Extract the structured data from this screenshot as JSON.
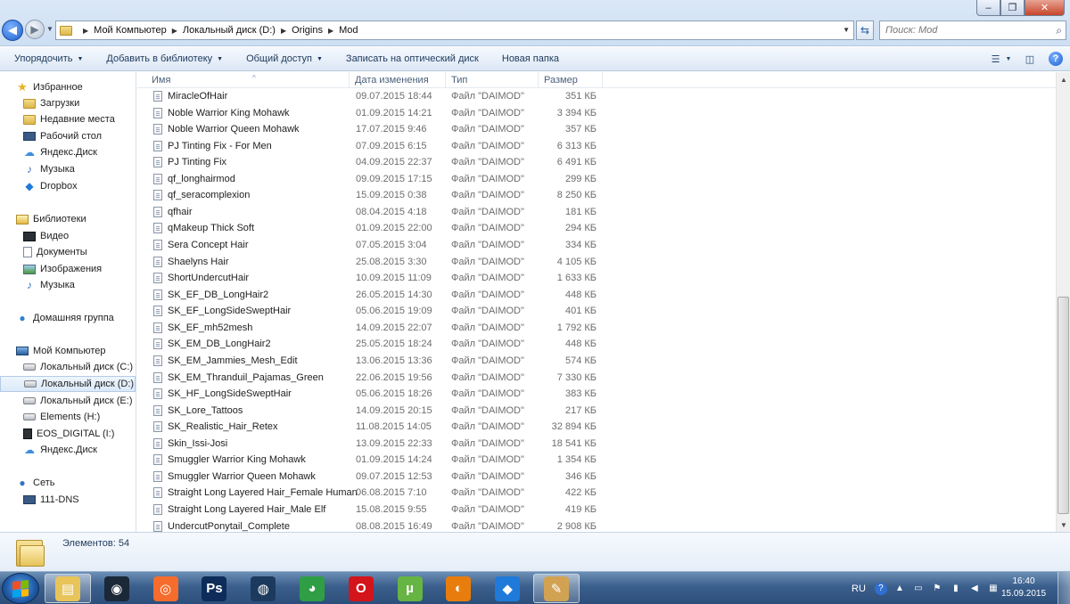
{
  "window": {
    "controls": {
      "minimize": "–",
      "maximize": "❐",
      "close": "✕"
    }
  },
  "address": {
    "crumbs": [
      "Мой Компьютер",
      "Локальный диск (D:)",
      "Origins",
      "Mod"
    ]
  },
  "search": {
    "placeholder": "Поиск: Mod"
  },
  "toolbar": {
    "organize": "Упорядочить",
    "add_to_library": "Добавить в библиотеку",
    "share": "Общий доступ",
    "burn": "Записать на оптический диск",
    "new_folder": "Новая папка"
  },
  "sidebar": {
    "favorites": {
      "label": "Избранное",
      "items": [
        "Загрузки",
        "Недавние места",
        "Рабочий стол",
        "Яндекс.Диск",
        "Музыка",
        "Dropbox"
      ]
    },
    "libraries": {
      "label": "Библиотеки",
      "items": [
        "Видео",
        "Документы",
        "Изображения",
        "Музыка"
      ]
    },
    "homegroup": {
      "label": "Домашняя группа"
    },
    "computer": {
      "label": "Мой Компьютер",
      "items": [
        "Локальный диск (C:)",
        "Локальный диск (D:)",
        "Локальный диск (E:)",
        "Elements (H:)",
        "EOS_DIGITAL (I:)",
        "Яндекс.Диск"
      ],
      "selected": "Локальный диск (D:)"
    },
    "network": {
      "label": "Сеть",
      "items": [
        "111-DNS"
      ]
    }
  },
  "columns": {
    "name": "Имя",
    "date": "Дата изменения",
    "type": "Тип",
    "size": "Размер"
  },
  "files": [
    {
      "name": "MiracleOfHair",
      "date": "09.07.2015 18:44",
      "type": "Файл \"DAIMOD\"",
      "size": "351 КБ"
    },
    {
      "name": "Noble Warrior King Mohawk",
      "date": "01.09.2015 14:21",
      "type": "Файл \"DAIMOD\"",
      "size": "3 394 КБ"
    },
    {
      "name": "Noble Warrior Queen Mohawk",
      "date": "17.07.2015 9:46",
      "type": "Файл \"DAIMOD\"",
      "size": "357 КБ"
    },
    {
      "name": "PJ Tinting Fix - For Men",
      "date": "07.09.2015 6:15",
      "type": "Файл \"DAIMOD\"",
      "size": "6 313 КБ"
    },
    {
      "name": "PJ Tinting Fix",
      "date": "04.09.2015 22:37",
      "type": "Файл \"DAIMOD\"",
      "size": "6 491 КБ"
    },
    {
      "name": "qf_longhairmod",
      "date": "09.09.2015 17:15",
      "type": "Файл \"DAIMOD\"",
      "size": "299 КБ"
    },
    {
      "name": "qf_seracomplexion",
      "date": "15.09.2015 0:38",
      "type": "Файл \"DAIMOD\"",
      "size": "8 250 КБ"
    },
    {
      "name": "qfhair",
      "date": "08.04.2015 4:18",
      "type": "Файл \"DAIMOD\"",
      "size": "181 КБ"
    },
    {
      "name": "qMakeup Thick Soft",
      "date": "01.09.2015 22:00",
      "type": "Файл \"DAIMOD\"",
      "size": "294 КБ"
    },
    {
      "name": "Sera Concept Hair",
      "date": "07.05.2015 3:04",
      "type": "Файл \"DAIMOD\"",
      "size": "334 КБ"
    },
    {
      "name": "Shaelyns Hair",
      "date": "25.08.2015 3:30",
      "type": "Файл \"DAIMOD\"",
      "size": "4 105 КБ"
    },
    {
      "name": "ShortUndercutHair",
      "date": "10.09.2015 11:09",
      "type": "Файл \"DAIMOD\"",
      "size": "1 633 КБ"
    },
    {
      "name": "SK_EF_DB_LongHair2",
      "date": "26.05.2015 14:30",
      "type": "Файл \"DAIMOD\"",
      "size": "448 КБ"
    },
    {
      "name": "SK_EF_LongSideSweptHair",
      "date": "05.06.2015 19:09",
      "type": "Файл \"DAIMOD\"",
      "size": "401 КБ"
    },
    {
      "name": "SK_EF_mh52mesh",
      "date": "14.09.2015 22:07",
      "type": "Файл \"DAIMOD\"",
      "size": "1 792 КБ"
    },
    {
      "name": "SK_EM_DB_LongHair2",
      "date": "25.05.2015 18:24",
      "type": "Файл \"DAIMOD\"",
      "size": "448 КБ"
    },
    {
      "name": "SK_EM_Jammies_Mesh_Edit",
      "date": "13.06.2015 13:36",
      "type": "Файл \"DAIMOD\"",
      "size": "574 КБ"
    },
    {
      "name": "SK_EM_Thranduil_Pajamas_Green",
      "date": "22.06.2015 19:56",
      "type": "Файл \"DAIMOD\"",
      "size": "7 330 КБ"
    },
    {
      "name": "SK_HF_LongSideSweptHair",
      "date": "05.06.2015 18:26",
      "type": "Файл \"DAIMOD\"",
      "size": "383 КБ"
    },
    {
      "name": "SK_Lore_Tattoos",
      "date": "14.09.2015 20:15",
      "type": "Файл \"DAIMOD\"",
      "size": "217 КБ"
    },
    {
      "name": "SK_Realistic_Hair_Retex",
      "date": "11.08.2015 14:05",
      "type": "Файл \"DAIMOD\"",
      "size": "32 894 КБ"
    },
    {
      "name": "Skin_Issi-Josi",
      "date": "13.09.2015 22:33",
      "type": "Файл \"DAIMOD\"",
      "size": "18 541 КБ"
    },
    {
      "name": "Smuggler Warrior King Mohawk",
      "date": "01.09.2015 14:24",
      "type": "Файл \"DAIMOD\"",
      "size": "1 354 КБ"
    },
    {
      "name": "Smuggler Warrior Queen Mohawk",
      "date": "09.07.2015 12:53",
      "type": "Файл \"DAIMOD\"",
      "size": "346 КБ"
    },
    {
      "name": "Straight Long Layered Hair_Female Human",
      "date": "06.08.2015 7:10",
      "type": "Файл \"DAIMOD\"",
      "size": "422 КБ"
    },
    {
      "name": "Straight Long Layered Hair_Male Elf",
      "date": "15.08.2015 9:55",
      "type": "Файл \"DAIMOD\"",
      "size": "419 КБ"
    },
    {
      "name": "UndercutPonytail_Complete",
      "date": "08.08.2015 16:49",
      "type": "Файл \"DAIMOD\"",
      "size": "2 908 КБ"
    }
  ],
  "status": {
    "count": "Элементов: 54"
  },
  "taskbar": {
    "apps": [
      {
        "icon": "explorer-icon",
        "color": "#e8c45a",
        "active": true
      },
      {
        "icon": "steam-icon",
        "color": "#1b2838",
        "active": false
      },
      {
        "icon": "origin-icon",
        "color": "#f56c2d",
        "active": false
      },
      {
        "icon": "photoshop-icon",
        "color": "#0d2c5a",
        "active": false
      },
      {
        "icon": "media-icon",
        "color": "#1c3a5e",
        "active": false
      },
      {
        "icon": "chrome-icon",
        "color": "#2f9e44",
        "active": false
      },
      {
        "icon": "opera-icon",
        "color": "#d4141b",
        "active": false
      },
      {
        "icon": "utorrent-icon",
        "color": "#66b443",
        "active": false
      },
      {
        "icon": "blender-icon",
        "color": "#e87d0d",
        "active": false
      },
      {
        "icon": "dropbox-icon",
        "color": "#1f7ad9",
        "active": false
      },
      {
        "icon": "paint-icon",
        "color": "#d2a253",
        "active": true
      }
    ],
    "tray": {
      "lang": "RU",
      "time": "16:40",
      "date": "15.09.2015"
    }
  }
}
